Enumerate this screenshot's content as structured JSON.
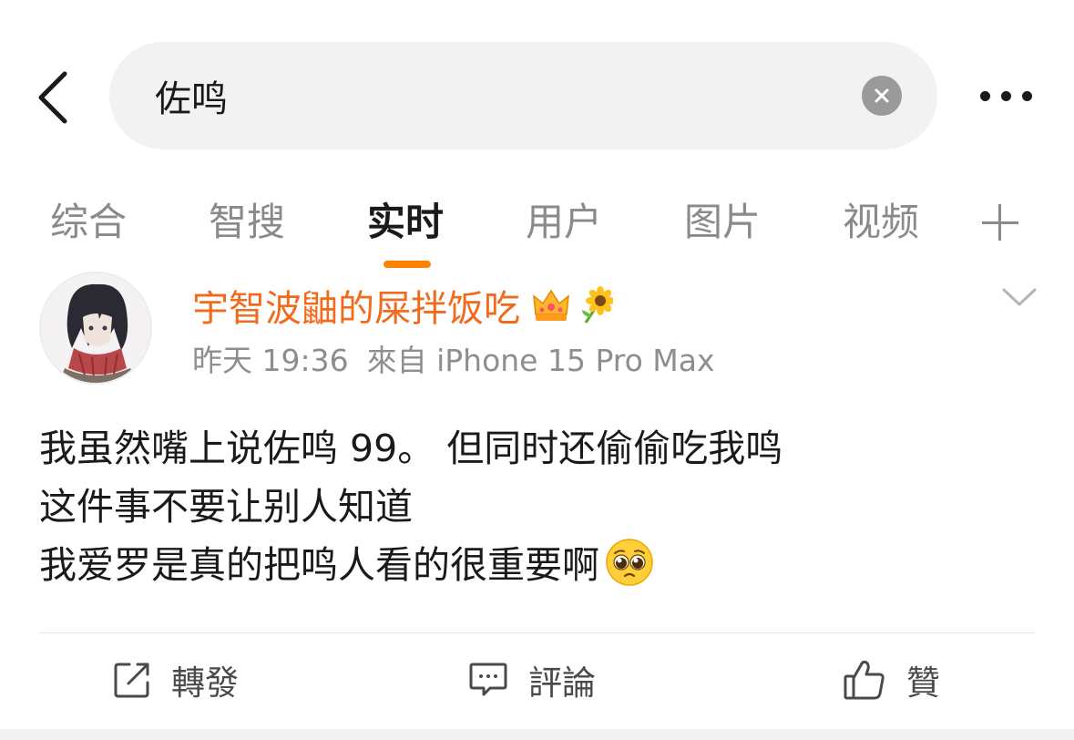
{
  "colors": {
    "accent": "#ff8200",
    "username": "#f26a1b",
    "tab_inactive": "#8a8a8a",
    "search_bg": "#f2f2f2"
  },
  "header": {
    "back_icon": "chevron-left-icon",
    "search": {
      "value": "佐鸣",
      "clear_icon": "clear-circle-icon"
    },
    "more_icon": "more-dots-icon"
  },
  "tabs": {
    "items": [
      {
        "label": "综合",
        "active": false
      },
      {
        "label": "智搜",
        "active": false
      },
      {
        "label": "实时",
        "active": true
      },
      {
        "label": "用户",
        "active": false
      },
      {
        "label": "图片",
        "active": false
      },
      {
        "label": "视频",
        "active": false
      }
    ],
    "add_icon": "plus-icon"
  },
  "post": {
    "username": "宇智波鼬的屎拌饭吃",
    "badges": [
      "crown-icon",
      "sunflower-icon"
    ],
    "time": "昨天 19:36",
    "source": "來自 iPhone 15 Pro Max",
    "body_lines": [
      "我虽然嘴上说佐鸣 99。 但同时还偷偷吃我鸣",
      "这件事不要让别人知道",
      "我爱罗是真的把鸣人看的很重要啊"
    ],
    "emoji": "pleading-face-icon"
  },
  "actions": {
    "repost": "轉發",
    "comment": "評論",
    "like": "贊"
  }
}
